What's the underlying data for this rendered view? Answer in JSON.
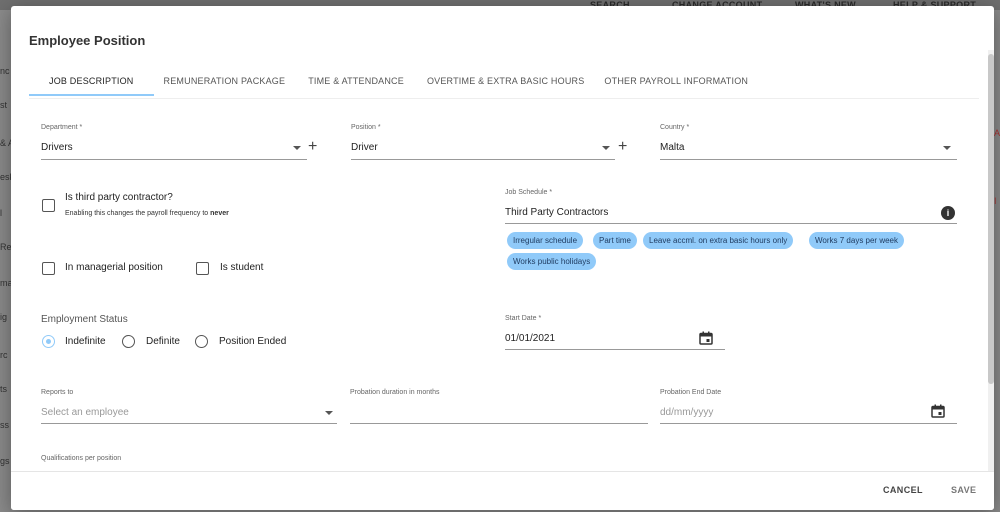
{
  "background": {
    "top_items": [
      "SEARCH",
      "CHANGE ACCOUNT",
      "WHAT'S NEW",
      "HELP & SUPPORT"
    ],
    "left_labels": [
      "nc",
      "st",
      "& A",
      "esk",
      "l",
      "Re",
      "ma",
      "ig",
      "rc",
      "ts",
      "ss",
      "gs"
    ],
    "right_labels": [
      "A",
      "I"
    ]
  },
  "modal": {
    "title": "Employee Position",
    "tabs": [
      "JOB DESCRIPTION",
      "REMUNERATION PACKAGE",
      "TIME & ATTENDANCE",
      "OVERTIME & EXTRA BASIC HOURS",
      "OTHER PAYROLL INFORMATION"
    ],
    "department": {
      "label": "Department *",
      "value": "Drivers"
    },
    "position": {
      "label": "Position *",
      "value": "Driver"
    },
    "country": {
      "label": "Country *",
      "value": "Malta"
    },
    "third_party": {
      "label": "Is third party contractor?",
      "hint_prefix": "Enabling this changes the payroll frequency to",
      "hint_bold": "never"
    },
    "managerial": {
      "label": "In managerial position"
    },
    "student": {
      "label": "Is student"
    },
    "job_schedule": {
      "label": "Job Schedule *",
      "value": "Third Party Contractors",
      "chips": [
        "Irregular schedule",
        "Part time",
        "Leave accml. on extra basic hours only",
        "Works 7 days per week",
        "Works public holidays"
      ]
    },
    "employment_status": {
      "title": "Employment Status",
      "options": [
        "Indefinite",
        "Definite",
        "Position Ended"
      ],
      "selected": "Indefinite"
    },
    "start_date": {
      "label": "Start Date *",
      "value": "01/01/2021"
    },
    "reports_to": {
      "label": "Reports to",
      "placeholder": "Select an employee"
    },
    "probation_duration": {
      "label": "Probation duration in months",
      "value": ""
    },
    "probation_end": {
      "label": "Probation End Date",
      "placeholder": "dd/mm/yyyy"
    },
    "qualifications": {
      "label": "Qualifications per position"
    },
    "footer": {
      "cancel": "CANCEL",
      "save": "SAVE"
    }
  },
  "colors": {
    "accent": "#90caf9",
    "chip_text": "#1e3a5f"
  },
  "icons": [
    "add-icon",
    "chevron-down-icon",
    "info-icon",
    "calendar-icon"
  ]
}
